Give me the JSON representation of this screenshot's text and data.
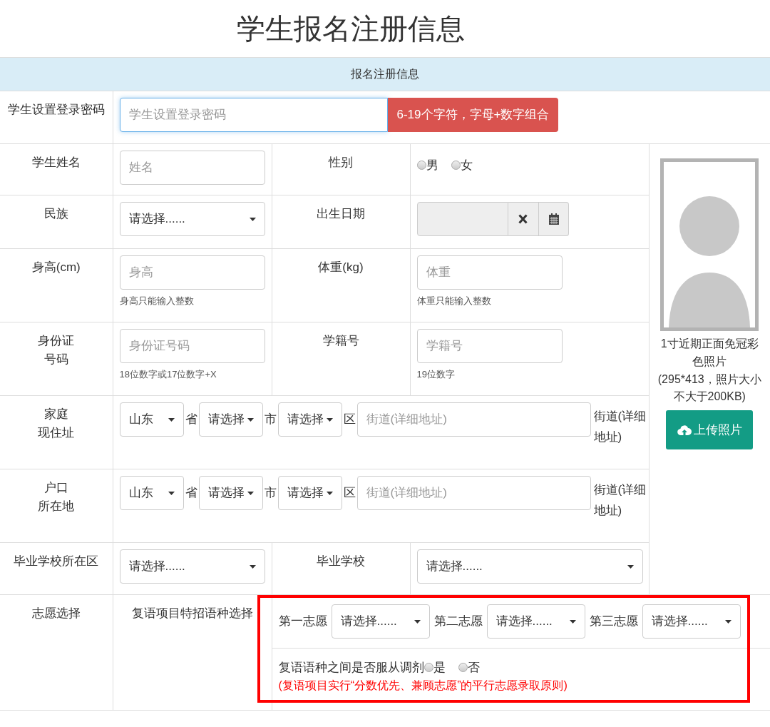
{
  "page_title": "学生报名注册信息",
  "section_header": "报名注册信息",
  "password": {
    "label": "学生设置登录密码",
    "placeholder": "学生设置登录密码",
    "hint": "6-19个字符，字母+数字组合"
  },
  "name": {
    "label": "学生姓名",
    "placeholder": "姓名"
  },
  "gender": {
    "label": "性别",
    "options": [
      {
        "label": "男",
        "selected": false
      },
      {
        "label": "女",
        "selected": false
      }
    ]
  },
  "ethnicity": {
    "label": "民族",
    "value": "请选择......"
  },
  "birth_date": {
    "label": "出生日期"
  },
  "height": {
    "label": "身高(cm)",
    "placeholder": "身高",
    "help": "身高只能输入整数"
  },
  "weight": {
    "label": "体重(kg)",
    "placeholder": "体重",
    "help": "体重只能输入整数"
  },
  "id_number": {
    "label_lines": [
      "身份证",
      "号码"
    ],
    "placeholder": "身份证号码",
    "help": "18位数字或17位数字+X"
  },
  "student_no": {
    "label": "学籍号",
    "placeholder": "学籍号",
    "help": "19位数字"
  },
  "addresses": [
    {
      "label_lines": [
        "家庭",
        "现住址"
      ],
      "province": "山东",
      "province_unit": "省",
      "city": "请选择",
      "city_unit": "市",
      "district": "请选择",
      "district_unit": "区",
      "street_placeholder": "街道(详细地址)",
      "suffix": "街道(详细地址)"
    },
    {
      "label_lines": [
        "户口",
        "所在地"
      ],
      "province": "山东",
      "province_unit": "省",
      "city": "请选择",
      "city_unit": "市",
      "district": "请选择",
      "district_unit": "区",
      "street_placeholder": "街道(详细地址)",
      "suffix": "街道(详细地址)"
    }
  ],
  "school_district": {
    "label": "毕业学校所在区",
    "value": "请选择......"
  },
  "school": {
    "label": "毕业学校",
    "value": "请选择......"
  },
  "photo": {
    "caption_lines": [
      "1寸近期正面免冠彩色照片",
      "(295*413，照片大小不大于200KB)"
    ],
    "upload_button": "上传照片"
  },
  "preferences": {
    "label": "志愿选择",
    "subject_label": "复语项目特招语种选择",
    "choices": [
      {
        "label": "第一志愿",
        "value": "请选择......"
      },
      {
        "label": "第二志愿",
        "value": "请选择......"
      },
      {
        "label": "第三志愿",
        "value": "请选择......"
      }
    ],
    "adjust_question": "复语语种之间是否服从调剂",
    "adjust_options": [
      {
        "label": "是",
        "selected": false
      },
      {
        "label": "否",
        "selected": false
      }
    ],
    "note": "(复语项目实行“分数优先、兼顾志愿”的平行志愿录取原则)"
  }
}
